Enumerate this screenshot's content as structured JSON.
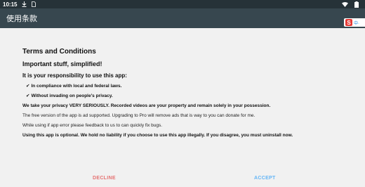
{
  "status_bar": {
    "time": "10:15",
    "icons": [
      "download-icon",
      "sim-card-icon",
      "wifi-icon",
      "battery-icon"
    ]
  },
  "app_bar": {
    "title": "使用条款"
  },
  "ime": {
    "logo": "S",
    "label": "中·"
  },
  "content": {
    "title": "Terms and Conditions",
    "subtitle": "Important stuff, simplified!",
    "responsibility": "It is your responsibility to use this app:",
    "bullets": [
      "In compliance with local and federal laws.",
      "Without invading on people's privacy."
    ],
    "privacy": "We take your privacy VERY SERIOUSLY. Recorded videos are your property and remain solely in your possession.",
    "ads": "The free version of the app is ad supported. Upgrading to Pro will remove ads that is way to you can donate for me.",
    "feedback": "While using if app error please feedback to us to can quickly fix bugs.",
    "liability": "Using this app is optional. We hold no liability if you choose to use this app illegally. If you disagree, you must uninstall now."
  },
  "buttons": {
    "decline": "DECLINE",
    "accept": "ACCEPT"
  }
}
